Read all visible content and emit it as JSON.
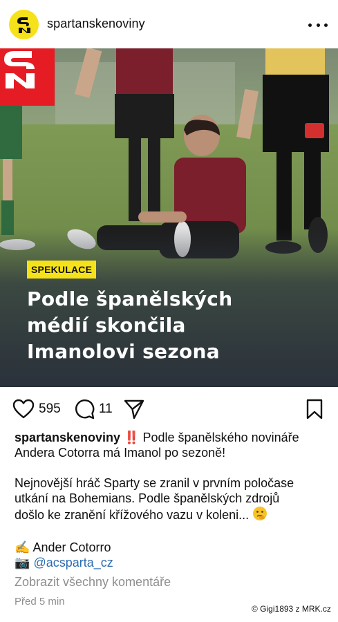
{
  "header": {
    "username": "spartanskenoviny",
    "avatar_text": "SN",
    "more_icon": "more-horizontal-icon"
  },
  "post_image": {
    "logo_text": "SN",
    "tag": "SPEKULACE",
    "headline_lines": [
      "Podle španělských",
      "médií skončila",
      "Imanolovi sezona"
    ],
    "colors": {
      "brand_red": "#e51c24",
      "brand_yellow": "#f6e21a"
    }
  },
  "actions": {
    "likes": "595",
    "comments": "11",
    "icons": [
      "heart-icon",
      "comment-icon",
      "share-icon",
      "bookmark-icon"
    ]
  },
  "caption": {
    "username": "spartanskenoviny",
    "line1_rest": "‼️ Podle španělského novináře",
    "line2": "Andera Cotorra má Imanol po sezoně!",
    "para2_line1": "Nejnovější hráč Sparty se zranil v prvním poločase",
    "para2_line2": "utkání na Bohemians. Podle španělských zdrojů",
    "para2_line3": "došlo ke zranění křížového vazu v koleni...",
    "author_emoji": "✍️",
    "author": "Ander Cotorro",
    "camera_emoji": "📷",
    "photo_credit": "@acsparta_cz"
  },
  "view_comments": "Zobrazit všechny komentáře",
  "timestamp": "Před 5 min",
  "watermark": "© Gigi1893 z MRK.cz"
}
